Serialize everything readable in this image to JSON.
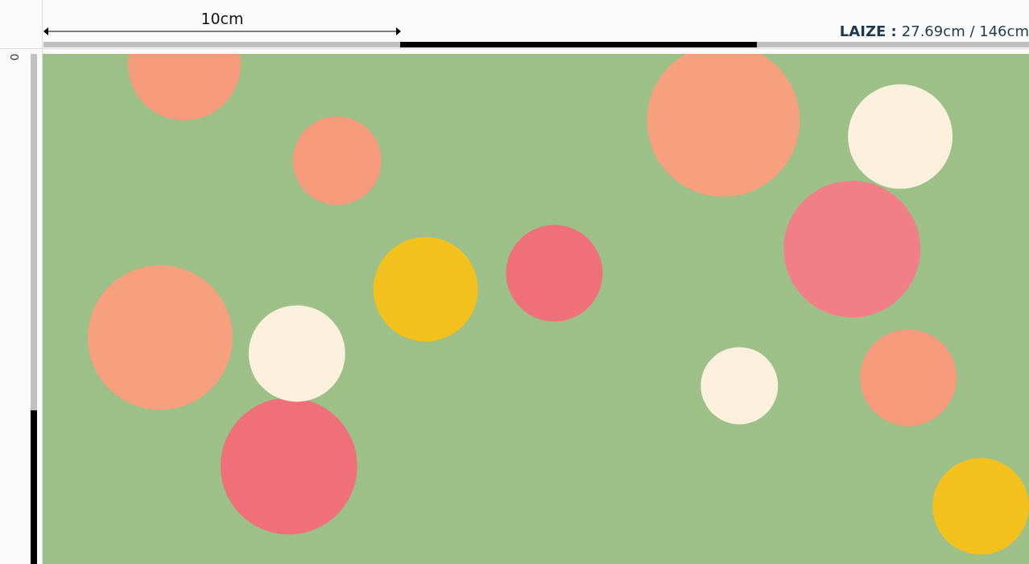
{
  "ruler": {
    "measure": "10cm",
    "origin": "0"
  },
  "width_info": {
    "label": "LAIZE :",
    "value": "27.69cm / 146cm"
  }
}
